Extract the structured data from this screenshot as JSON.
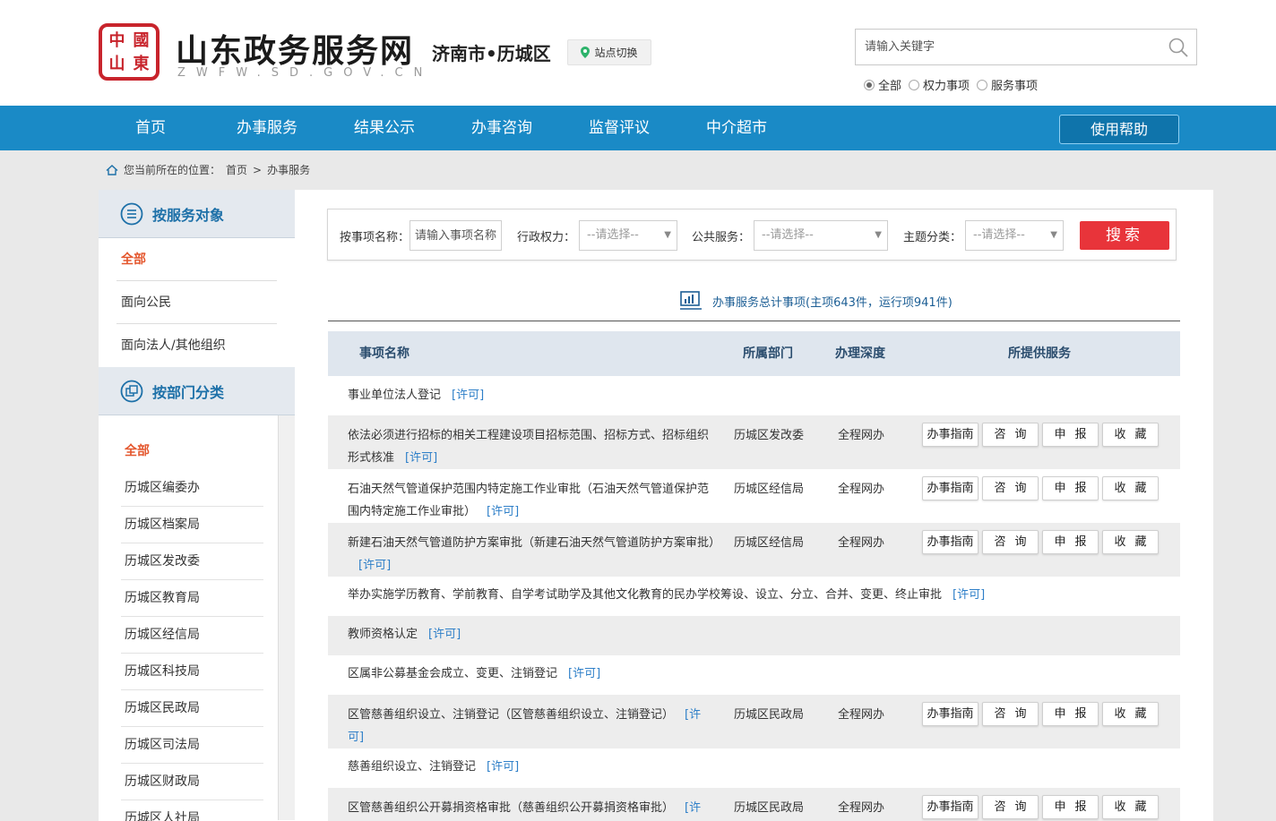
{
  "header": {
    "seal_chars": [
      "中",
      "國",
      "山",
      "東"
    ],
    "site_title": "山东政务服务网",
    "site_sub": "ZWFW.SD.GOV.CN",
    "region": "济南市•历城区",
    "switch_label": "站点切换",
    "search_placeholder": "请输入关键字",
    "scope": [
      {
        "label": "全部",
        "selected": true
      },
      {
        "label": "权力事项",
        "selected": false
      },
      {
        "label": "服务事项",
        "selected": false
      }
    ]
  },
  "nav": {
    "items": [
      "首页",
      "办事服务",
      "结果公示",
      "办事咨询",
      "监督评议",
      "中介超市"
    ],
    "help": "使用帮助"
  },
  "breadcrumb": {
    "prefix": "您当前所在的位置：",
    "home": "首页",
    "sep": ">",
    "current": "办事服务"
  },
  "sidebar": {
    "by_object_title": "按服务对象",
    "objects": [
      "全部",
      "面向公民",
      "面向法人/其他组织"
    ],
    "by_dept_title": "按部门分类",
    "depts": [
      "全部",
      "历城区编委办",
      "历城区档案局",
      "历城区发改委",
      "历城区教育局",
      "历城区经信局",
      "历城区科技局",
      "历城区民政局",
      "历城区司法局",
      "历城区财政局",
      "历城区人社局"
    ]
  },
  "filter": {
    "name_label": "按事项名称：",
    "name_placeholder": "请输入事项名称",
    "admin_label": "行政权力：",
    "admin_value": "--请选择--",
    "public_label": "公共服务：",
    "public_value": "--请选择--",
    "topic_label": "主题分类：",
    "topic_value": "--请选择--",
    "search_btn": "搜索"
  },
  "stats": "办事服务总计事项(主项643件，运行项941件)",
  "table": {
    "headers": [
      "事项名称",
      "所属部门",
      "办理深度",
      "所提供服务"
    ],
    "actions": [
      "办事指南",
      "咨询",
      "申报",
      "收藏"
    ],
    "rows": [
      {
        "name": "事业单位法人登记",
        "tag": "[许可]"
      },
      {
        "name": "依法必须进行招标的相关工程建设项目招标范围、招标方式、招标组织形式核准",
        "tag": "[许可]",
        "dept": "历城区发改委",
        "depth": "全程网办"
      },
      {
        "name": "石油天然气管道保护范围内特定施工作业审批（石油天然气管道保护范围内特定施工作业审批）",
        "tag": "[许可]",
        "dept": "历城区经信局",
        "depth": "全程网办"
      },
      {
        "name": "新建石油天然气管道防护方案审批（新建石油天然气管道防护方案审批）",
        "tag": "[许可]",
        "dept": "历城区经信局",
        "depth": "全程网办"
      },
      {
        "name": "举办实施学历教育、学前教育、自学考试助学及其他文化教育的民办学校筹设、设立、分立、合并、变更、终止审批",
        "tag": "[许可]"
      },
      {
        "name": "教师资格认定",
        "tag": "[许可]"
      },
      {
        "name": "区属非公募基金会成立、变更、注销登记",
        "tag": "[许可]"
      },
      {
        "name": "区管慈善组织设立、注销登记（区管慈善组织设立、注销登记）",
        "tag": "[许可]",
        "dept": "历城区民政局",
        "depth": "全程网办"
      },
      {
        "name": "慈善组织设立、注销登记",
        "tag": "[许可]"
      },
      {
        "name": "区管慈善组织公开募捐资格审批（慈善组织公开募捐资格审批）",
        "tag": "[许可]",
        "dept": "历城区民政局",
        "depth": "全程网办"
      }
    ]
  },
  "colors": {
    "nav_bg": "#1a8ac6",
    "accent_red": "#e8343a",
    "active_orange": "#e4572e",
    "link_blue": "#2e7fc8"
  }
}
